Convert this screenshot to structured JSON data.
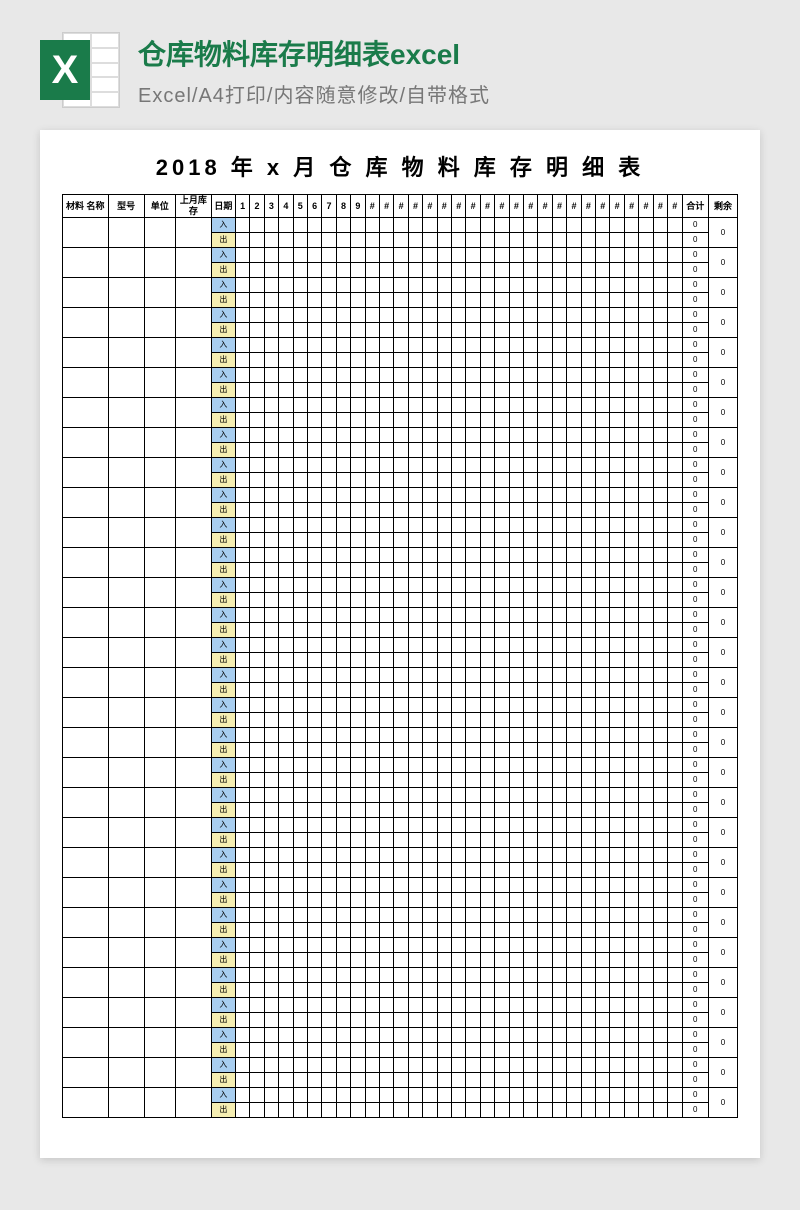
{
  "header": {
    "title": "仓库物料库存明细表excel",
    "subtitle": "Excel/A4打印/内容随意修改/自带格式",
    "icon_letter": "X"
  },
  "sheet": {
    "title": "2018 年 x 月 仓 库 物 料 库 存 明 细 表",
    "columns": {
      "material_name": "材料\n名称",
      "model": "型号",
      "unit": "单位",
      "prev_stock": "上月库\n存",
      "date_label": "日期",
      "total": "合计",
      "remain": "剩余"
    },
    "day_headers": [
      "1",
      "2",
      "3",
      "4",
      "5",
      "6",
      "7",
      "8",
      "9",
      "#",
      "#",
      "#",
      "#",
      "#",
      "#",
      "#",
      "#",
      "#",
      "#",
      "#",
      "#",
      "#",
      "#",
      "#",
      "#",
      "#",
      "#",
      "#",
      "#",
      "#",
      "#"
    ],
    "in_label": "入",
    "out_label": "出",
    "zero": "0",
    "num_materials": 30
  }
}
